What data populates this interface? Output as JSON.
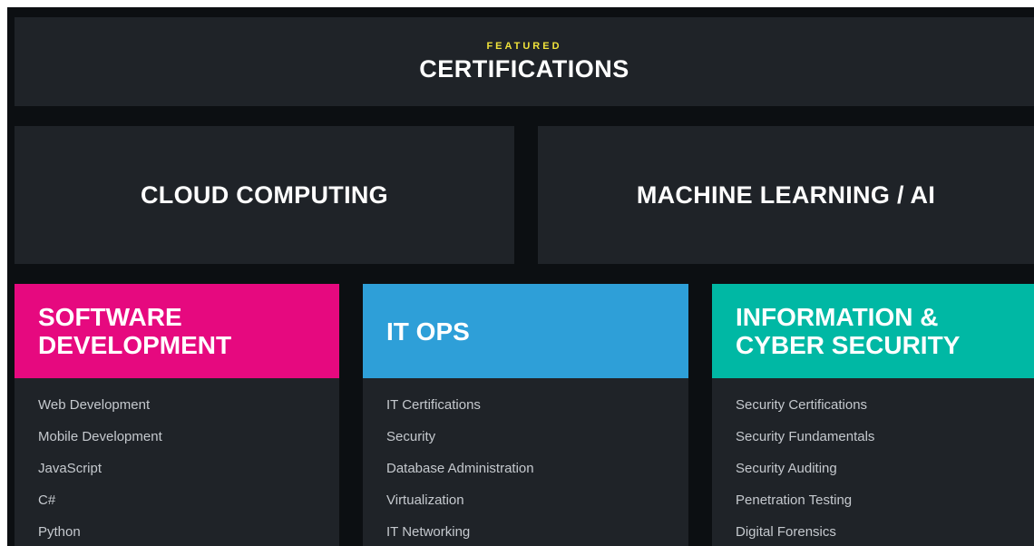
{
  "featured": {
    "kicker": "FEATURED",
    "title": "CERTIFICATIONS"
  },
  "categories": [
    {
      "label": "CLOUD COMPUTING"
    },
    {
      "label": "MACHINE LEARNING / AI"
    }
  ],
  "columns": [
    {
      "title": "SOFTWARE\nDEVELOPMENT",
      "color": "#e6097f",
      "items": [
        "Web Development",
        "Mobile Development",
        "JavaScript",
        "C#",
        "Python"
      ]
    },
    {
      "title": "IT OPS",
      "color": "#2e9fd8",
      "items": [
        "IT Certifications",
        "Security",
        "Database Administration",
        "Virtualization",
        "IT Networking"
      ]
    },
    {
      "title": "INFORMATION &\nCYBER SECURITY",
      "color": "#00b8a4",
      "items": [
        "Security Certifications",
        "Security Fundamentals",
        "Security Auditing",
        "Penetration Testing",
        "Digital Forensics"
      ]
    }
  ],
  "colors": {
    "page_bg": "#0c0f12",
    "panel_bg": "#1f2328",
    "kicker": "#f0e23a"
  }
}
